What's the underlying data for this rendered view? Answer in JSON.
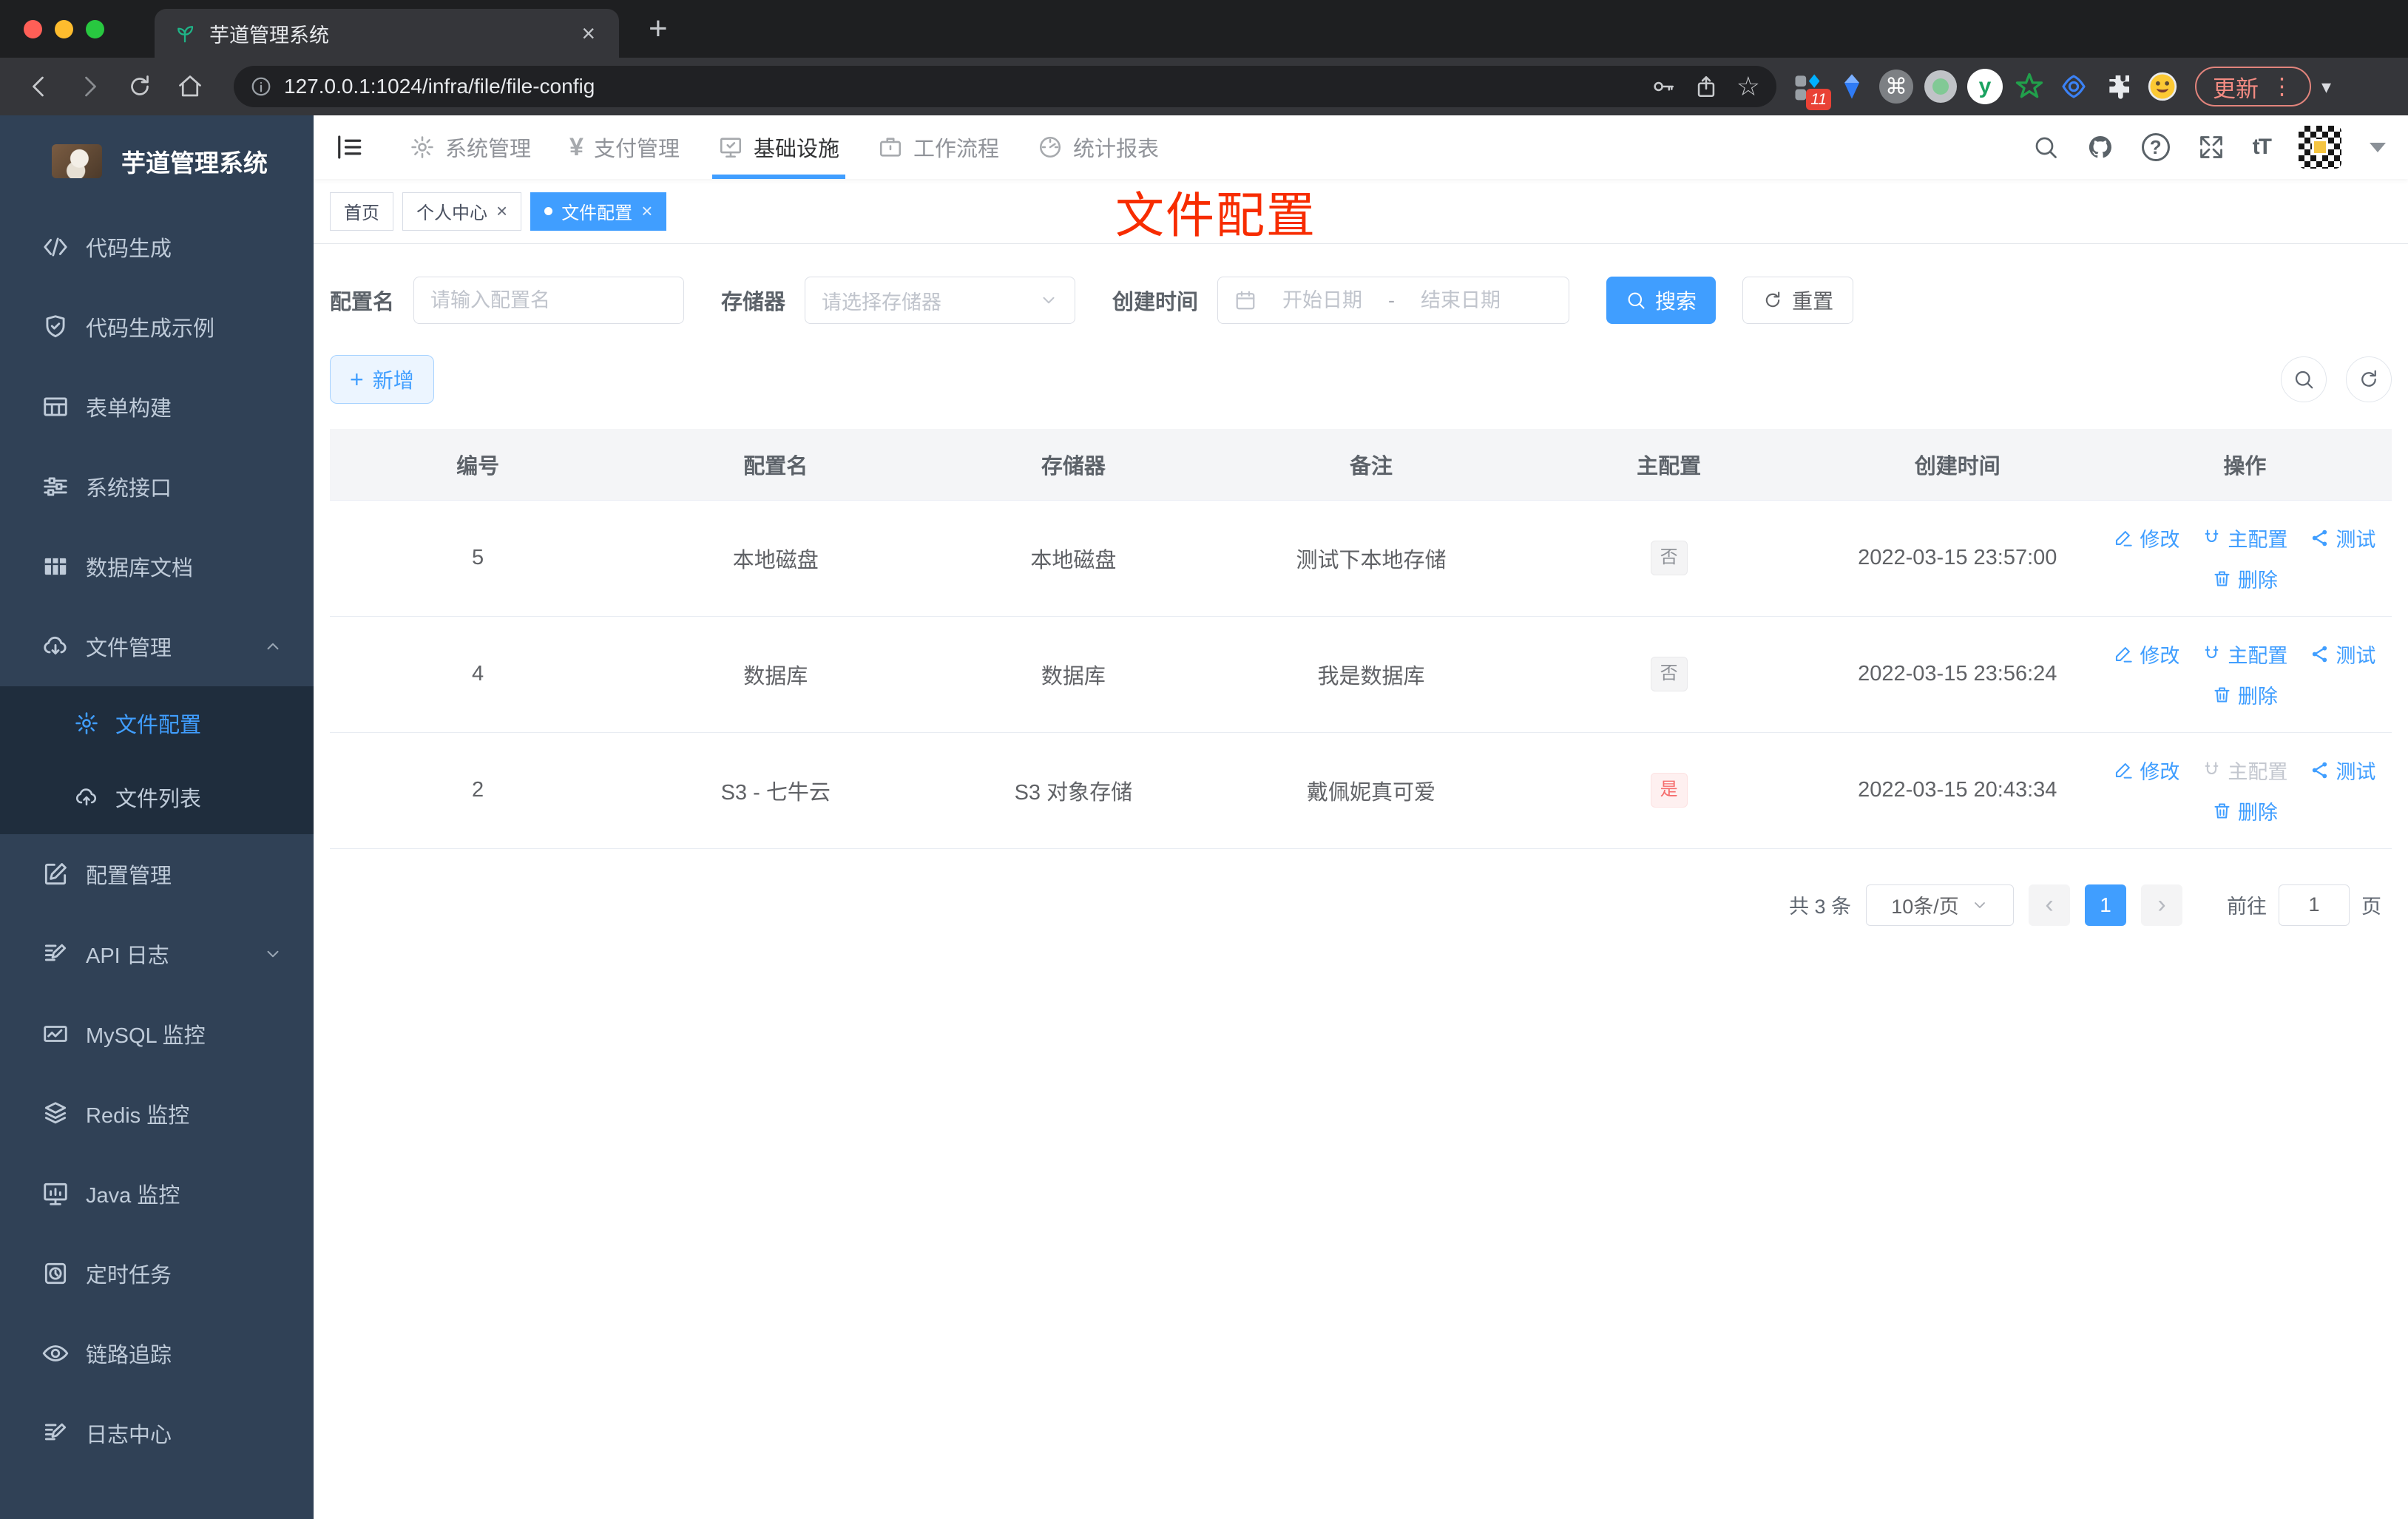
{
  "colors": {
    "accent": "#409eff",
    "danger": "#f56c6c",
    "info_text": "#909399",
    "annotation_red": "#f72c00",
    "sidebar_bg": "#304156",
    "submenu_bg": "#1f2d3d"
  },
  "browser": {
    "tab_title": "芋道管理系统",
    "url": "127.0.0.1:1024/infra/file/file-config",
    "update_label": "更新",
    "ext_badge": "11"
  },
  "glyphs": {
    "close": "×",
    "new_tab": "+",
    "dots": "⋮",
    "cmd": "⌘",
    "star": "☆",
    "yen": "¥",
    "question": "?",
    "font_size": "tT",
    "caret_down": "▾",
    "prev": "‹",
    "next": "›",
    "y_logo": "y",
    "plus": "+",
    "dash": "-"
  },
  "annotation": {
    "text": "文件配置"
  },
  "sidebar": {
    "title": "芋道管理系统",
    "items": [
      {
        "label": "代码生成",
        "icon": "code-icon"
      },
      {
        "label": "代码生成示例",
        "icon": "shield-check-icon"
      },
      {
        "label": "表单构建",
        "icon": "form-icon"
      },
      {
        "label": "系统接口",
        "icon": "sliders-icon"
      },
      {
        "label": "数据库文档",
        "icon": "table-grid-icon"
      },
      {
        "label": "文件管理",
        "icon": "cloud-download-icon",
        "expanded": true
      }
    ],
    "submenu": [
      {
        "label": "文件配置",
        "icon": "gear-icon",
        "active": true
      },
      {
        "label": "文件列表",
        "icon": "cloud-upload-icon"
      }
    ],
    "items2": [
      {
        "label": "配置管理",
        "icon": "edit-square-icon"
      },
      {
        "label": "API 日志",
        "icon": "log-edit-icon",
        "collapsed": true
      },
      {
        "label": "MySQL 监控",
        "icon": "chart-icon"
      },
      {
        "label": "Redis 监控",
        "icon": "layers-icon"
      },
      {
        "label": "Java 监控",
        "icon": "monitor-icon"
      },
      {
        "label": "定时任务",
        "icon": "timer-icon"
      },
      {
        "label": "链路追踪",
        "icon": "eye-icon"
      },
      {
        "label": "日志中心",
        "icon": "log-center-icon"
      }
    ]
  },
  "topnav": {
    "items": [
      {
        "label": "系统管理",
        "icon": "gear-icon"
      },
      {
        "label": "支付管理",
        "icon": "yen-icon"
      },
      {
        "label": "基础设施",
        "icon": "monitor-check-icon",
        "active": true
      },
      {
        "label": "工作流程",
        "icon": "briefcase-icon"
      },
      {
        "label": "统计报表",
        "icon": "dashboard-icon"
      }
    ]
  },
  "tags": [
    {
      "label": "首页",
      "closable": false,
      "active": false
    },
    {
      "label": "个人中心",
      "closable": true,
      "active": false
    },
    {
      "label": "文件配置",
      "closable": true,
      "active": true
    }
  ],
  "filters": {
    "name_label": "配置名",
    "name_placeholder": "请输入配置名",
    "storage_label": "存储器",
    "storage_placeholder": "请选择存储器",
    "time_label": "创建时间",
    "start_placeholder": "开始日期",
    "range_separator": "-",
    "end_placeholder": "结束日期",
    "search_label": "搜索",
    "reset_label": "重置"
  },
  "toolbar": {
    "add_label": "新增"
  },
  "table": {
    "headers": [
      "编号",
      "配置名",
      "存储器",
      "备注",
      "主配置",
      "创建时间",
      "操作"
    ],
    "actions": {
      "edit": "修改",
      "master": "主配置",
      "test": "测试",
      "delete": "删除"
    },
    "rows": [
      {
        "id": "5",
        "name": "本地磁盘",
        "storage": "本地磁盘",
        "remark": "测试下本地存储",
        "master": "否",
        "master_type": "info",
        "created": "2022-03-15 23:57:00",
        "master_action_disabled": false
      },
      {
        "id": "4",
        "name": "数据库",
        "storage": "数据库",
        "remark": "我是数据库",
        "master": "否",
        "master_type": "info",
        "created": "2022-03-15 23:56:24",
        "master_action_disabled": false
      },
      {
        "id": "2",
        "name": "S3 - 七牛云",
        "storage": "S3 对象存储",
        "remark": "戴佩妮真可爱",
        "master": "是",
        "master_type": "danger",
        "created": "2022-03-15 20:43:34",
        "master_action_disabled": true
      }
    ]
  },
  "pagination": {
    "total": "共 3 条",
    "page_size": "10条/页",
    "current_page": "1",
    "goto_label": "前往",
    "goto_value": "1",
    "page_unit": "页"
  }
}
